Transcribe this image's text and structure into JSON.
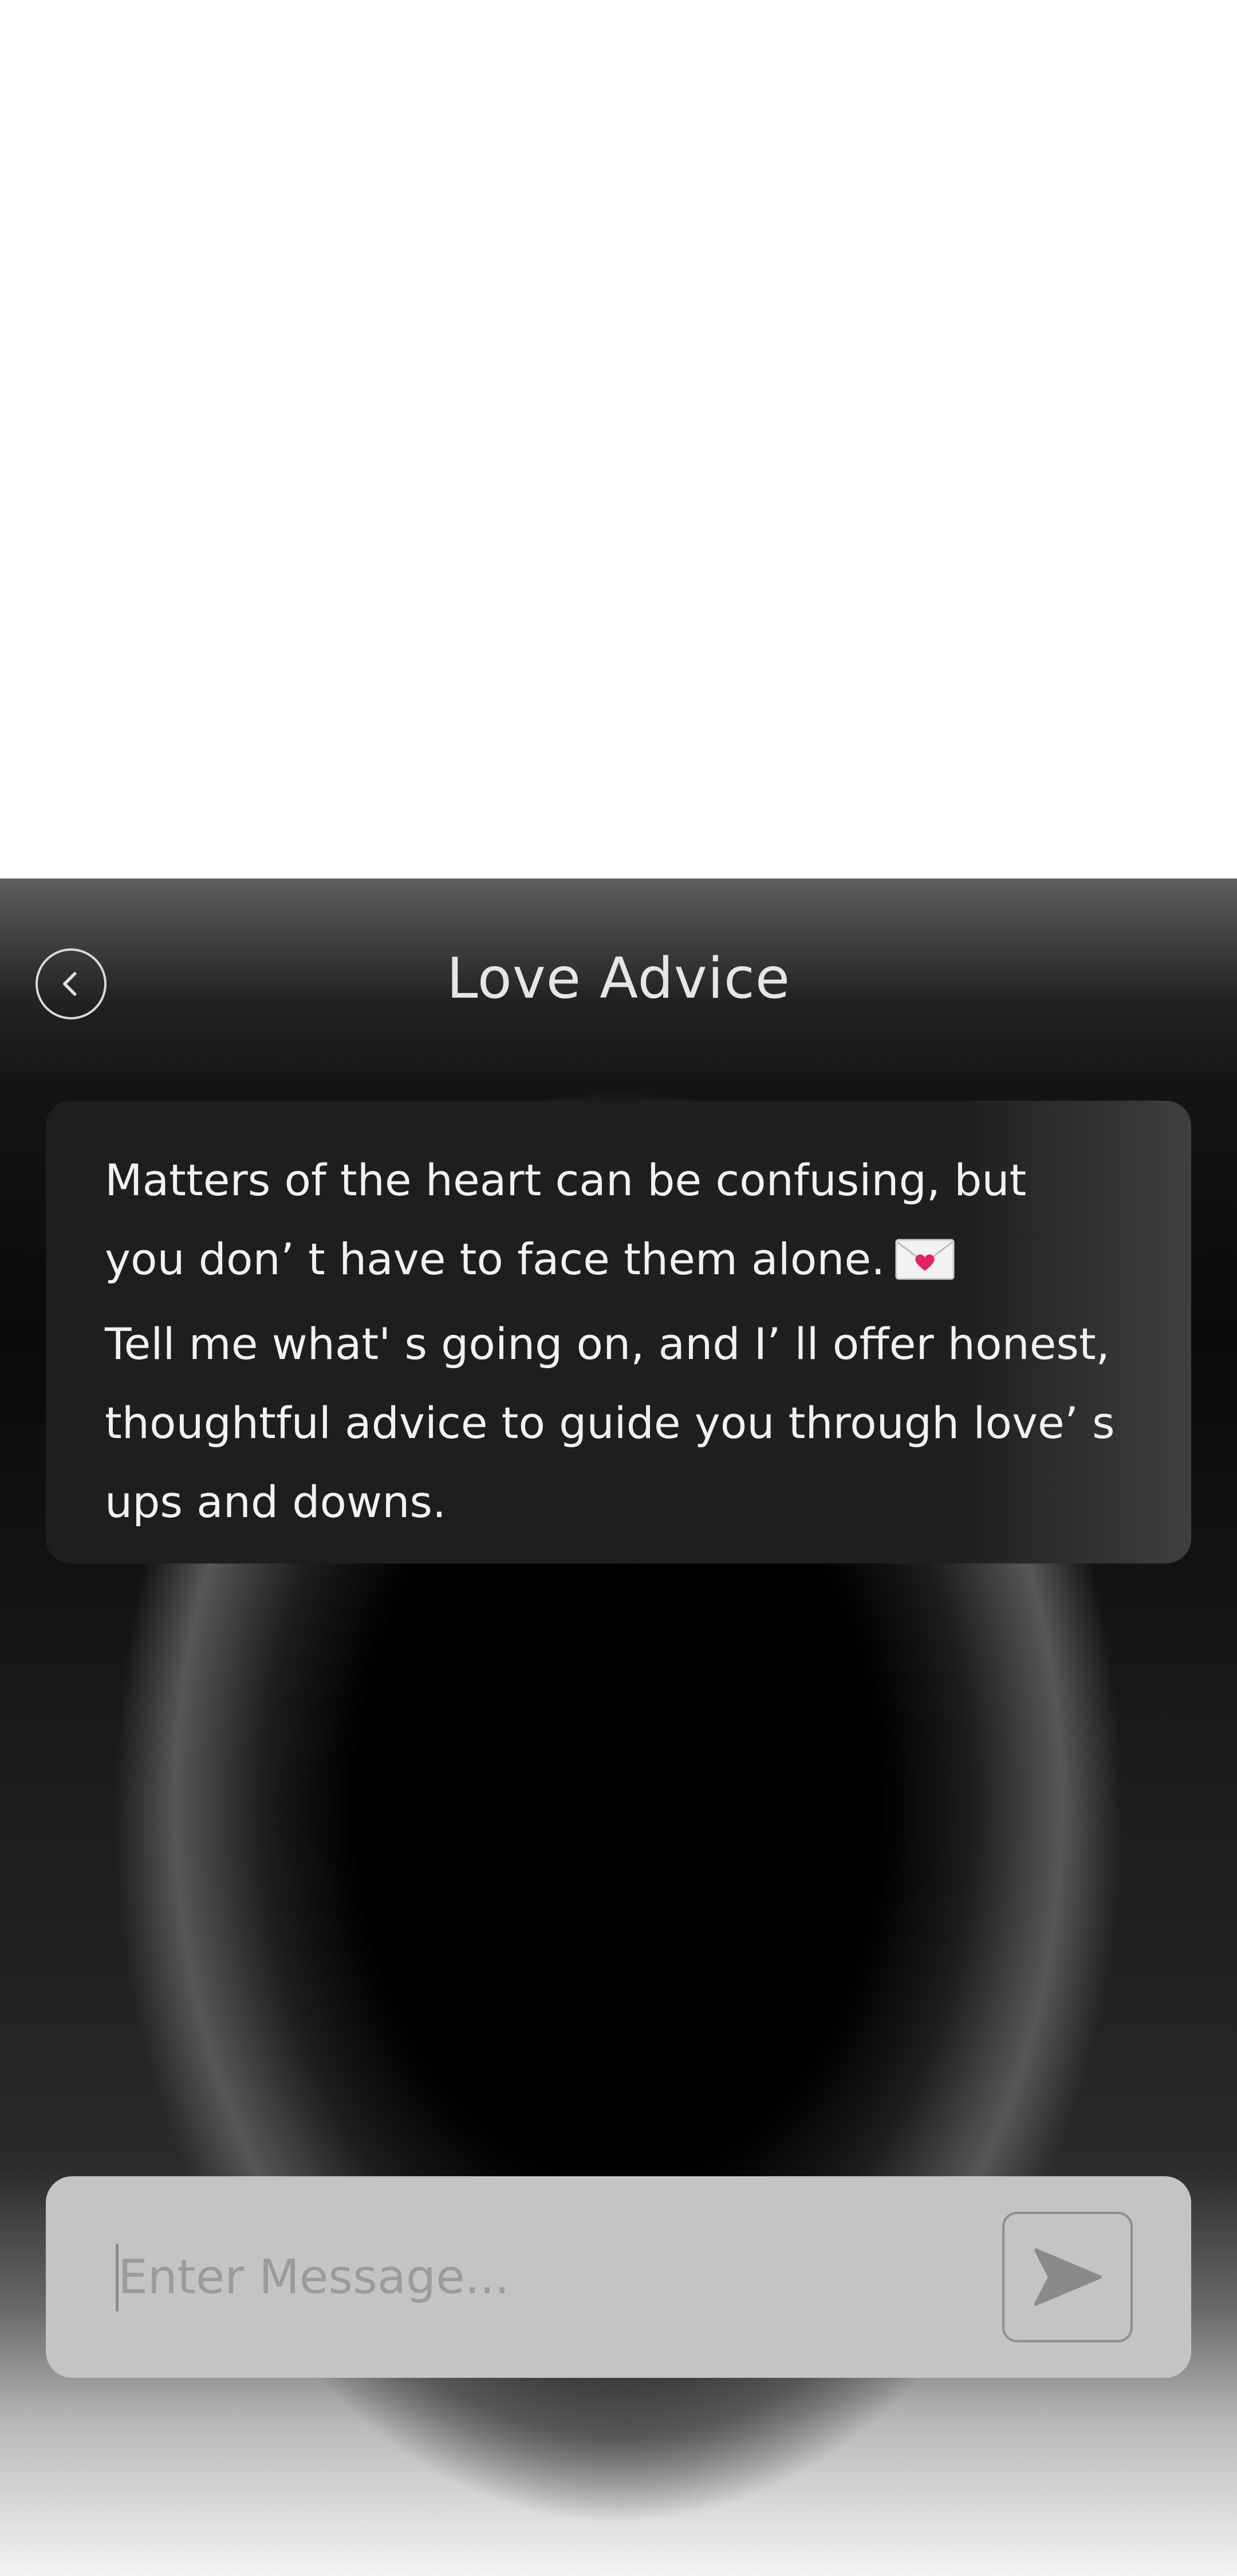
{
  "header": {
    "title": "Love Advice",
    "back_icon": "chevron-left-icon"
  },
  "chat": {
    "messages": [
      {
        "role": "assistant",
        "lines": [
          "Matters of the heart can be confusing, but",
          "you don’ t have to face them alone.",
          "Tell me what' s going on, and I’ ll offer honest,",
          "thoughtful advice to guide you through love’ s",
          "ups and downs."
        ],
        "emoji": "love-letter-envelope-icon"
      }
    ]
  },
  "composer": {
    "placeholder": "Enter Message...",
    "value": "",
    "send_icon": "send-arrow-icon"
  }
}
